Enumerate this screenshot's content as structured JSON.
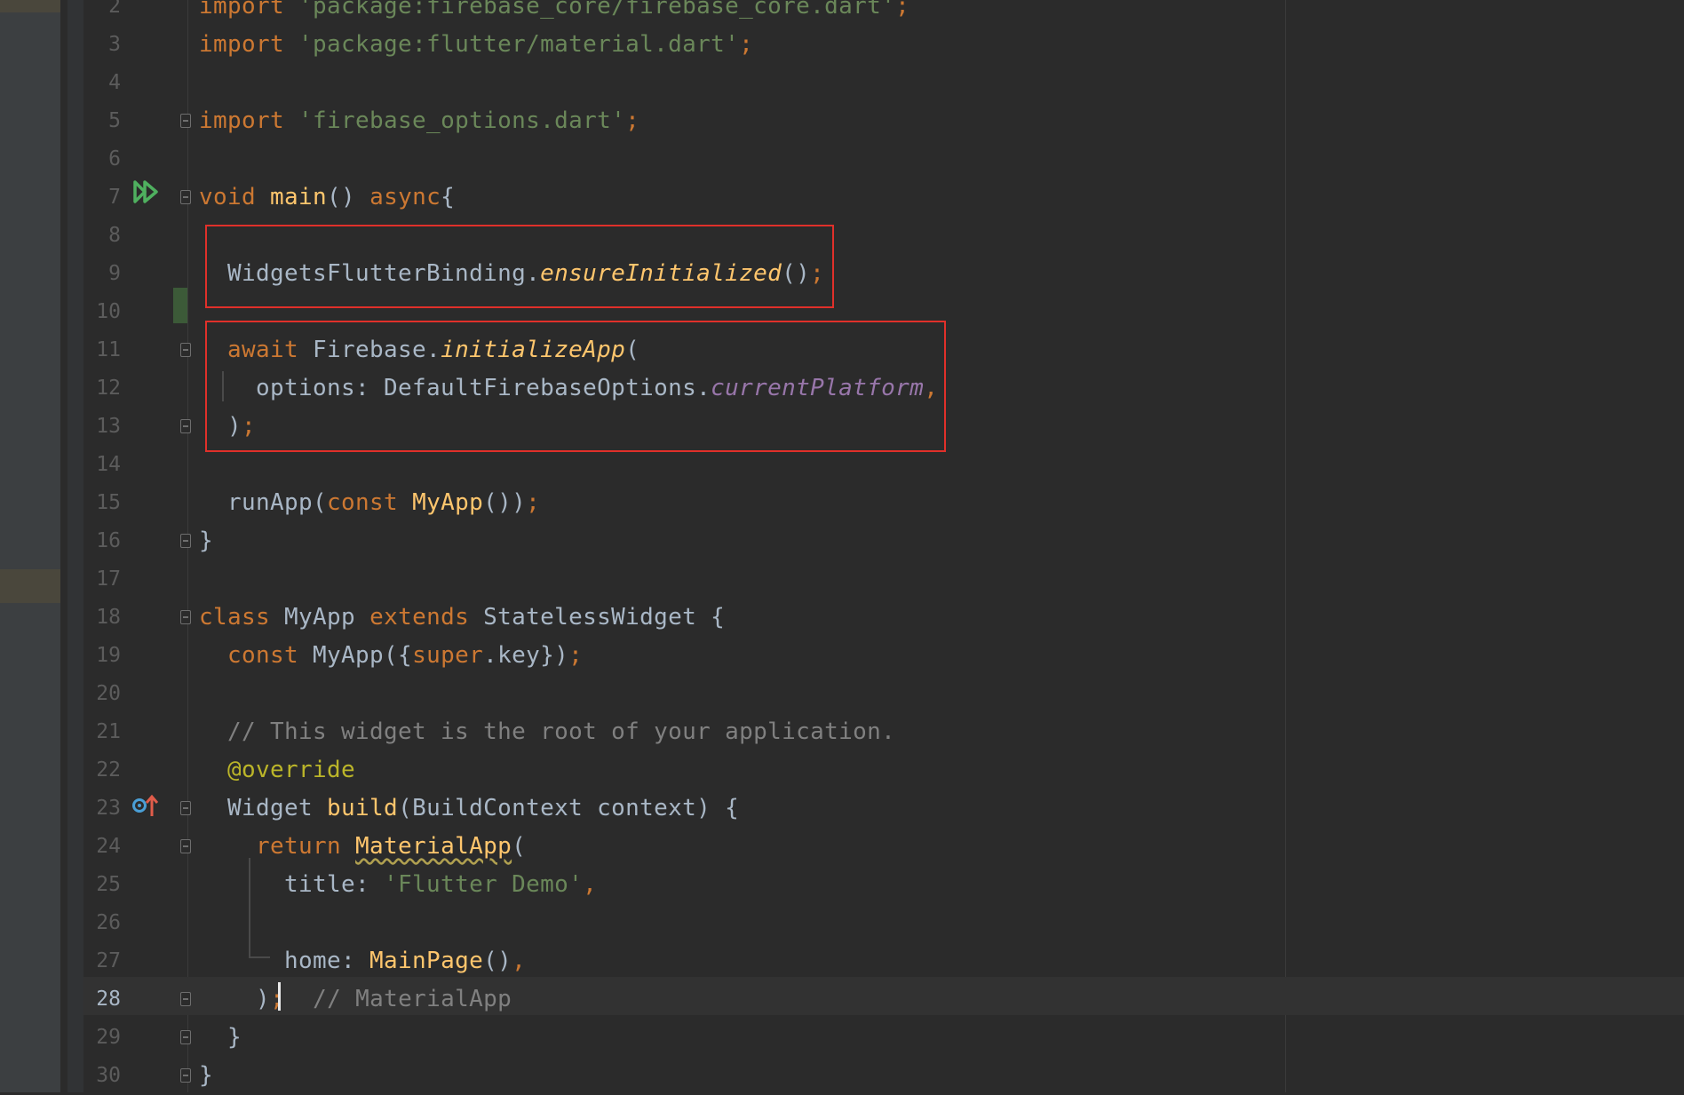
{
  "editor": {
    "current_line": 28,
    "lines": [
      {
        "num": "2",
        "segments": [
          [
            "kw",
            "import "
          ],
          [
            "str",
            "'package:firebase_core/firebase_core.dart'"
          ],
          [
            "kw",
            ";"
          ]
        ]
      },
      {
        "num": "3",
        "segments": [
          [
            "kw",
            "import "
          ],
          [
            "str",
            "'package:flutter/material.dart'"
          ],
          [
            "kw",
            ";"
          ]
        ]
      },
      {
        "num": "4",
        "segments": []
      },
      {
        "num": "5",
        "segments": [
          [
            "kw",
            "import "
          ],
          [
            "str",
            "'firebase_options.dart'"
          ],
          [
            "kw",
            ";"
          ]
        ]
      },
      {
        "num": "6",
        "segments": []
      },
      {
        "num": "7",
        "segments": [
          [
            "kw",
            "void "
          ],
          [
            "fn",
            "main"
          ],
          [
            "",
            "() "
          ],
          [
            "kw",
            "async"
          ],
          [
            "",
            "{"
          ]
        ]
      },
      {
        "num": "8",
        "segments": []
      },
      {
        "num": "9",
        "segments": [
          [
            "",
            "  WidgetsFlutterBinding."
          ],
          [
            "fni",
            "ensureInitialized"
          ],
          [
            "",
            "()"
          ],
          [
            "kw",
            ";"
          ]
        ]
      },
      {
        "num": "10",
        "segments": []
      },
      {
        "num": "11",
        "segments": [
          [
            "kw",
            "  await "
          ],
          [
            "",
            "Firebase."
          ],
          [
            "fni",
            "initializeApp"
          ],
          [
            "",
            "("
          ]
        ]
      },
      {
        "num": "12",
        "segments": [
          [
            "",
            "    options: DefaultFirebaseOptions."
          ],
          [
            "prop",
            "currentPlatform"
          ],
          [
            "kw",
            ","
          ]
        ]
      },
      {
        "num": "13",
        "segments": [
          [
            "",
            "  )"
          ],
          [
            "kw",
            ";"
          ]
        ]
      },
      {
        "num": "14",
        "segments": []
      },
      {
        "num": "15",
        "segments": [
          [
            "",
            "  runApp("
          ],
          [
            "kw",
            "const "
          ],
          [
            "fn",
            "MyApp"
          ],
          [
            "",
            "())"
          ],
          [
            "kw",
            ";"
          ]
        ]
      },
      {
        "num": "16",
        "segments": [
          [
            "",
            "}"
          ]
        ]
      },
      {
        "num": "17",
        "segments": []
      },
      {
        "num": "18",
        "segments": [
          [
            "kw",
            "class "
          ],
          [
            "",
            "MyApp "
          ],
          [
            "kw",
            "extends "
          ],
          [
            "",
            "StatelessWidget {"
          ]
        ]
      },
      {
        "num": "19",
        "segments": [
          [
            "kw",
            "  const "
          ],
          [
            "",
            "MyApp({"
          ],
          [
            "sup",
            "super"
          ],
          [
            "",
            ".key})"
          ],
          [
            "kw",
            ";"
          ]
        ]
      },
      {
        "num": "20",
        "segments": []
      },
      {
        "num": "21",
        "segments": [
          [
            "cm",
            "  // This widget is the root of your application."
          ]
        ]
      },
      {
        "num": "22",
        "segments": [
          [
            "ann",
            "  @override"
          ]
        ]
      },
      {
        "num": "23",
        "segments": [
          [
            "",
            "  Widget "
          ],
          [
            "fn",
            "build"
          ],
          [
            "",
            "(BuildContext context) {"
          ]
        ]
      },
      {
        "num": "24",
        "segments": [
          [
            "kw",
            "    return "
          ],
          [
            "fn wavy",
            "MaterialApp"
          ],
          [
            "",
            "("
          ]
        ]
      },
      {
        "num": "25",
        "segments": [
          [
            "",
            "      title: "
          ],
          [
            "str",
            "'Flutter Demo'"
          ],
          [
            "kw",
            ","
          ]
        ]
      },
      {
        "num": "26",
        "segments": []
      },
      {
        "num": "27",
        "segments": [
          [
            "",
            "      home: "
          ],
          [
            "fn",
            "MainPage"
          ],
          [
            "",
            "()"
          ],
          [
            "kw",
            ","
          ]
        ]
      },
      {
        "num": "28",
        "segments": [
          [
            "",
            "    )"
          ],
          [
            "kw",
            ";"
          ],
          [
            "",
            "  "
          ],
          [
            "cm",
            "// MaterialApp"
          ]
        ]
      },
      {
        "num": "29",
        "segments": [
          [
            "",
            "  }"
          ]
        ]
      },
      {
        "num": "30",
        "segments": [
          [
            "",
            "}"
          ]
        ]
      }
    ],
    "fold_lines": [
      "5",
      "7",
      "11",
      "13",
      "16",
      "18",
      "23",
      "24",
      "28",
      "29",
      "30"
    ],
    "highlight_colors": {
      "box": "#e0302a",
      "keyword": "#cc7832",
      "string": "#6a8759",
      "function": "#ffc66d"
    },
    "gutter_icons": {
      "line_7": "run-gutter-icon",
      "line_23": "override-gutter-icon"
    }
  }
}
